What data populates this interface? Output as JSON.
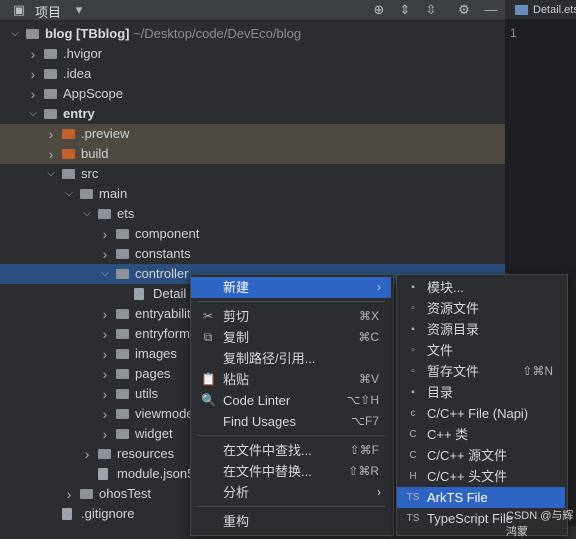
{
  "toolbar": {
    "title": "项目"
  },
  "editor": {
    "tab_label": "Detail.ets",
    "line_number": "1"
  },
  "tree": [
    {
      "label": "blog [TBblog]",
      "suffix": " ~/Desktop/code/DevEco/blog",
      "indent": 0,
      "arrow": "down",
      "icon": "dir",
      "bold": true
    },
    {
      "label": ".hvigor",
      "indent": 1,
      "arrow": "right",
      "icon": "dir"
    },
    {
      "label": ".idea",
      "indent": 1,
      "arrow": "right",
      "icon": "dir"
    },
    {
      "label": "AppScope",
      "indent": 1,
      "arrow": "right",
      "icon": "dir"
    },
    {
      "label": "entry",
      "indent": 1,
      "arrow": "down",
      "icon": "dir",
      "bold": true
    },
    {
      "label": ".preview",
      "indent": 2,
      "arrow": "right",
      "icon": "orange",
      "hl": true
    },
    {
      "label": "build",
      "indent": 2,
      "arrow": "right",
      "icon": "orange",
      "hl": true
    },
    {
      "label": "src",
      "indent": 2,
      "arrow": "down",
      "icon": "dir"
    },
    {
      "label": "main",
      "indent": 3,
      "arrow": "down",
      "icon": "dir"
    },
    {
      "label": "ets",
      "indent": 4,
      "arrow": "down",
      "icon": "dir"
    },
    {
      "label": "component",
      "indent": 5,
      "arrow": "right",
      "icon": "dir"
    },
    {
      "label": "constants",
      "indent": 5,
      "arrow": "right",
      "icon": "dir"
    },
    {
      "label": "controller",
      "indent": 5,
      "arrow": "down",
      "icon": "dir",
      "sel": true
    },
    {
      "label": "Detail",
      "indent": 6,
      "arrow": "",
      "icon": "file"
    },
    {
      "label": "entryability",
      "indent": 5,
      "arrow": "right",
      "icon": "dir"
    },
    {
      "label": "entryform",
      "indent": 5,
      "arrow": "right",
      "icon": "dir"
    },
    {
      "label": "images",
      "indent": 5,
      "arrow": "right",
      "icon": "dir"
    },
    {
      "label": "pages",
      "indent": 5,
      "arrow": "right",
      "icon": "dir"
    },
    {
      "label": "utils",
      "indent": 5,
      "arrow": "right",
      "icon": "dir"
    },
    {
      "label": "viewmodel",
      "indent": 5,
      "arrow": "right",
      "icon": "dir"
    },
    {
      "label": "widget",
      "indent": 5,
      "arrow": "right",
      "icon": "dir"
    },
    {
      "label": "resources",
      "indent": 4,
      "arrow": "right",
      "icon": "dir"
    },
    {
      "label": "module.json5",
      "indent": 4,
      "arrow": "",
      "icon": "file"
    },
    {
      "label": "ohosTest",
      "indent": 3,
      "arrow": "right",
      "icon": "dir"
    },
    {
      "label": ".gitignore",
      "indent": 2,
      "arrow": "",
      "icon": "file"
    }
  ],
  "context_menu": [
    {
      "label": "新建",
      "icon": "",
      "shortcut": "",
      "submenu": true,
      "active": true
    },
    {
      "sep": true
    },
    {
      "label": "剪切",
      "icon": "✂",
      "shortcut": "⌘X"
    },
    {
      "label": "复制",
      "icon": "⧉",
      "shortcut": "⌘C"
    },
    {
      "label": "复制路径/引用...",
      "icon": "",
      "shortcut": ""
    },
    {
      "label": "粘贴",
      "icon": "📋",
      "shortcut": "⌘V"
    },
    {
      "label": "Code Linter",
      "icon": "🔍",
      "shortcut": "⌥⇧H"
    },
    {
      "label": "Find Usages",
      "icon": "",
      "shortcut": "⌥F7"
    },
    {
      "sep": true
    },
    {
      "label": "在文件中查找...",
      "icon": "",
      "shortcut": "⇧⌘F"
    },
    {
      "label": "在文件中替换...",
      "icon": "",
      "shortcut": "⇧⌘R"
    },
    {
      "label": "分析",
      "icon": "",
      "shortcut": "",
      "submenu": true
    },
    {
      "sep": true
    },
    {
      "label": "重构",
      "icon": "",
      "shortcut": ""
    }
  ],
  "submenu": [
    {
      "label": "模块...",
      "icon": "▪"
    },
    {
      "label": "资源文件",
      "icon": "▫"
    },
    {
      "label": "资源目录",
      "icon": "▪"
    },
    {
      "label": "文件",
      "icon": "▫"
    },
    {
      "label": "暂存文件",
      "icon": "▫",
      "shortcut": "⇧⌘N"
    },
    {
      "label": "目录",
      "icon": "▪"
    },
    {
      "label": "C/C++ File (Napi)",
      "icon": "c"
    },
    {
      "label": "C++ 类",
      "icon": "C"
    },
    {
      "label": "C/C++ 源文件",
      "icon": "C"
    },
    {
      "label": "C/C++ 头文件",
      "icon": "H"
    },
    {
      "label": "ArkTS File",
      "icon": "TS",
      "active": true
    },
    {
      "label": "TypeScript File",
      "icon": "TS"
    }
  ],
  "watermark": "CSDN @与辉鸿蒙"
}
